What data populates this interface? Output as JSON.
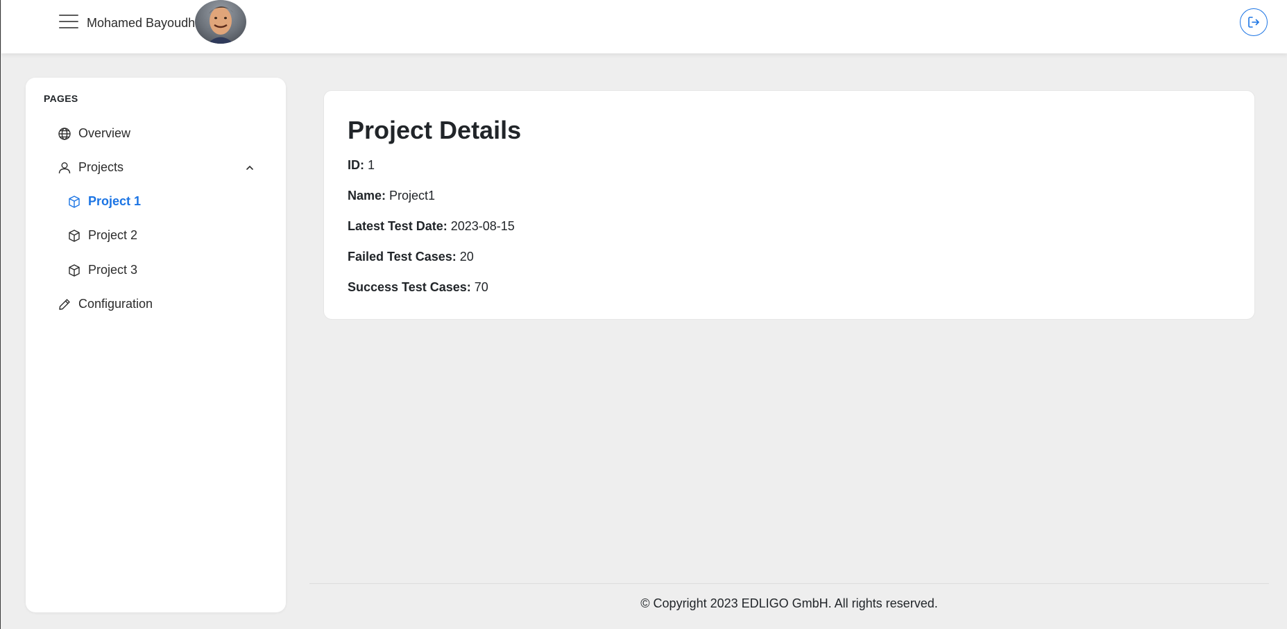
{
  "header": {
    "username": "Mohamed Bayoudhi",
    "menu_icon": "hamburger-menu-icon",
    "logout_icon": "logout-icon",
    "accent_color": "#1b74e4"
  },
  "sidebar": {
    "heading": "PAGES",
    "items": [
      {
        "label": "Overview",
        "icon": "globe-icon"
      },
      {
        "label": "Projects",
        "icon": "user-icon",
        "expanded": true
      },
      {
        "label": "Project 1",
        "icon": "cube-icon",
        "active": true
      },
      {
        "label": "Project 2",
        "icon": "cube-icon"
      },
      {
        "label": "Project 3",
        "icon": "cube-icon"
      },
      {
        "label": "Configuration",
        "icon": "pencil-icon"
      }
    ]
  },
  "main": {
    "title": "Project Details",
    "details": [
      {
        "label": "ID:",
        "value": "1"
      },
      {
        "label": "Name:",
        "value": "Project1"
      },
      {
        "label": "Latest Test Date:",
        "value": "2023-08-15"
      },
      {
        "label": "Failed Test Cases:",
        "value": "20"
      },
      {
        "label": "Success Test Cases:",
        "value": "70"
      }
    ]
  },
  "footer": {
    "text": "© Copyright 2023 EDLIGO GmbH. All rights reserved."
  }
}
